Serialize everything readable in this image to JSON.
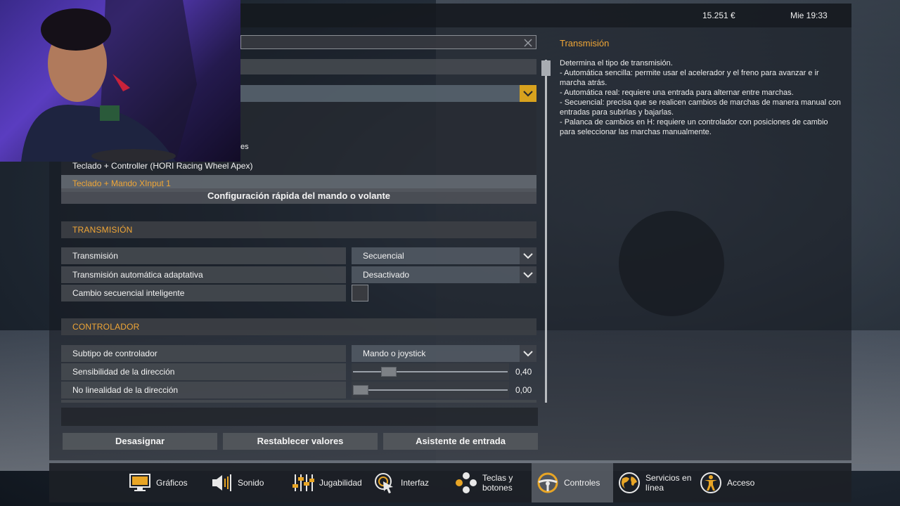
{
  "topbar": {
    "money": "15.251 €",
    "clock": "Mie 19:33"
  },
  "controller_menu": {
    "partial_text": "es",
    "options": [
      "Teclado + Controller (HORI Racing Wheel Apex)",
      "Teclado + Mando XInput 1"
    ],
    "quick_config": "Configuración rápida del mando o volante"
  },
  "transmission_section": {
    "header": "TRANSMISIÓN",
    "rows": [
      {
        "label": "Transmisión",
        "value": "Secuencial"
      },
      {
        "label": "Transmisión automática adaptativa",
        "value": "Desactivado"
      },
      {
        "label": "Cambio secuencial inteligente"
      }
    ]
  },
  "controller_section": {
    "header": "CONTROLADOR",
    "subtype": {
      "label": "Subtipo de controlador",
      "value": "Mando o joystick"
    },
    "sliders": [
      {
        "label": "Sensibilidad de la dirección",
        "value": "0,40",
        "level": 0.4
      },
      {
        "label": "No linealidad de la dirección",
        "value": "0,00",
        "level": 0.0
      }
    ]
  },
  "buttons": {
    "unassign": "Desasignar",
    "reset": "Restablecer valores",
    "wizard": "Asistente de entrada"
  },
  "info": {
    "title": "Transmisión",
    "lines": [
      "Determina el tipo de transmisión.",
      "- Automática sencilla: permite usar el acelerador y el freno para avanzar e ir marcha atrás.",
      "- Automática real: requiere una entrada para alternar entre marchas.",
      "- Secuencial: precisa que se realicen cambios de marchas de manera manual con entradas para subirlas y bajarlas.",
      "- Palanca de cambios en H: requiere un controlador con posiciones de cambio para seleccionar las marchas manualmente."
    ]
  },
  "nav": [
    {
      "label": "Gráficos",
      "icon": "monitor-icon"
    },
    {
      "label": "Sonido",
      "icon": "speaker-icon"
    },
    {
      "label": "Jugabilidad",
      "icon": "sliders-icon"
    },
    {
      "label": "Interfaz",
      "icon": "cursor-icon"
    },
    {
      "label": "Teclas y botones",
      "icon": "gamepad-buttons-icon"
    },
    {
      "label": "Controles",
      "icon": "steering-wheel-icon",
      "active": true
    },
    {
      "label": "Servicios en línea",
      "icon": "globe-icon"
    },
    {
      "label": "Acceso",
      "icon": "accessibility-icon"
    }
  ],
  "colors": {
    "accent": "#f0a636",
    "active_tab": "#5a6068"
  }
}
